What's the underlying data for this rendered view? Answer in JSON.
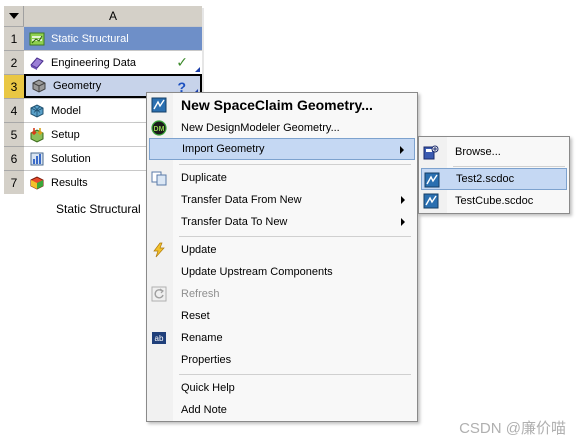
{
  "system": {
    "column_header": "A",
    "caption": "Static Structural",
    "rows": [
      {
        "num": "1",
        "label": "Static Structural",
        "icon": "static-structural-icon"
      },
      {
        "num": "2",
        "label": "Engineering Data",
        "icon": "engineering-data-icon",
        "status": "✓"
      },
      {
        "num": "3",
        "label": "Geometry",
        "icon": "geometry-icon",
        "status": "?"
      },
      {
        "num": "4",
        "label": "Model",
        "icon": "model-icon"
      },
      {
        "num": "5",
        "label": "Setup",
        "icon": "setup-icon"
      },
      {
        "num": "6",
        "label": "Solution",
        "icon": "solution-icon"
      },
      {
        "num": "7",
        "label": "Results",
        "icon": "results-icon"
      }
    ]
  },
  "context_menu": {
    "items": [
      {
        "label": "New SpaceClaim Geometry..."
      },
      {
        "label": "New DesignModeler Geometry..."
      },
      {
        "label": "Import Geometry"
      },
      {
        "label": "Duplicate"
      },
      {
        "label": "Transfer Data From New"
      },
      {
        "label": "Transfer Data To New"
      },
      {
        "label": "Update"
      },
      {
        "label": "Update Upstream Components"
      },
      {
        "label": "Refresh"
      },
      {
        "label": "Reset"
      },
      {
        "label": "Rename"
      },
      {
        "label": "Properties"
      },
      {
        "label": "Quick Help"
      },
      {
        "label": "Add Note"
      }
    ]
  },
  "submenu": {
    "items": [
      {
        "label": "Browse..."
      },
      {
        "label": "Test2.scdoc"
      },
      {
        "label": "TestCube.scdoc"
      }
    ]
  },
  "watermark": "CSDN @廉价喵",
  "colors": {
    "title_row": "#6e8fc8",
    "selected_row": "#c7d3ea",
    "menu_highlight": "#c5d8f3",
    "highlight_border": "#7da2ce"
  }
}
